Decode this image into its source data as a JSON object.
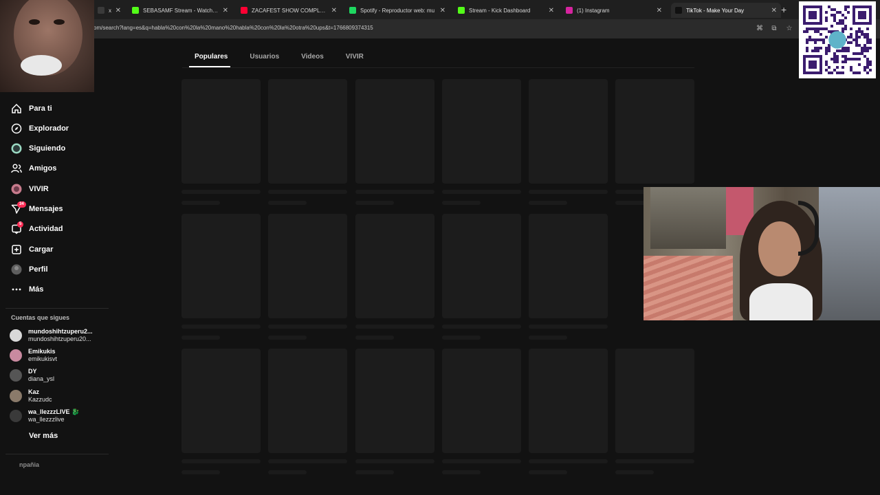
{
  "browser": {
    "tabs": [
      {
        "title": "xofic",
        "favicon_color": "#3a3a3a",
        "active": false
      },
      {
        "title": "SEBASAMF Stream - Watch Live",
        "favicon_color": "#53fc18",
        "active": false
      },
      {
        "title": "ZACAFEST SHOW COMPLETO -",
        "favicon_color": "#ff0033",
        "active": false
      },
      {
        "title": "Spotify - Reproductor web: mu",
        "favicon_color": "#1ed760",
        "active": false
      },
      {
        "title": "Stream - Kick Dashboard",
        "favicon_color": "#53fc18",
        "active": false
      },
      {
        "title": "(1) Instagram",
        "favicon_color": "#d6249f",
        "active": false
      },
      {
        "title": "TikTok - Make Your Day",
        "favicon_color": "#111111",
        "active": true
      }
    ],
    "url": "om/search?lang=es&q=habla%20con%20la%20mano%20habla%20con%20la%20otra%20ups&t=1766809374315"
  },
  "search_tabs": [
    "Populares",
    "Usuarios",
    "Videos",
    "VIVIR"
  ],
  "sidebar": {
    "items": [
      {
        "label": "Para ti",
        "icon": "home-icon"
      },
      {
        "label": "Explorador",
        "icon": "compass-icon"
      },
      {
        "label": "Siguiendo",
        "icon": "following-icon"
      },
      {
        "label": "Amigos",
        "icon": "friends-icon"
      },
      {
        "label": "VIVIR",
        "icon": "live-icon"
      },
      {
        "label": "Mensajes",
        "icon": "message-icon",
        "badge": "34"
      },
      {
        "label": "Actividad",
        "icon": "activity-icon",
        "badge": "5"
      },
      {
        "label": "Cargar",
        "icon": "upload-icon"
      },
      {
        "label": "Perfil",
        "icon": "profile-icon"
      },
      {
        "label": "Más",
        "icon": "more-icon"
      }
    ],
    "following_title": "Cuentas que sigues",
    "accounts": [
      {
        "name": "mundoshihtzuperu2...",
        "user": "mundoshihtzuperu20...",
        "avatar_color": "#d9d9d9"
      },
      {
        "name": "Emikukis",
        "user": "emikukisvt",
        "avatar_color": "#c98aa0"
      },
      {
        "name": "DY",
        "user": "diana_ysl",
        "avatar_color": "#555555"
      },
      {
        "name": "Kaz",
        "user": "Kazzudc",
        "avatar_color": "#8a7a6a"
      },
      {
        "name": "wa_llezzzLIVE 🐉",
        "user": "wa_llezzzlive",
        "avatar_color": "#3a3a3a"
      }
    ],
    "see_more": "Ver más",
    "company": "npañia"
  },
  "colors": {
    "background": "#121212",
    "skeleton": "#1c1c1c",
    "badge": "#fe2c55"
  }
}
